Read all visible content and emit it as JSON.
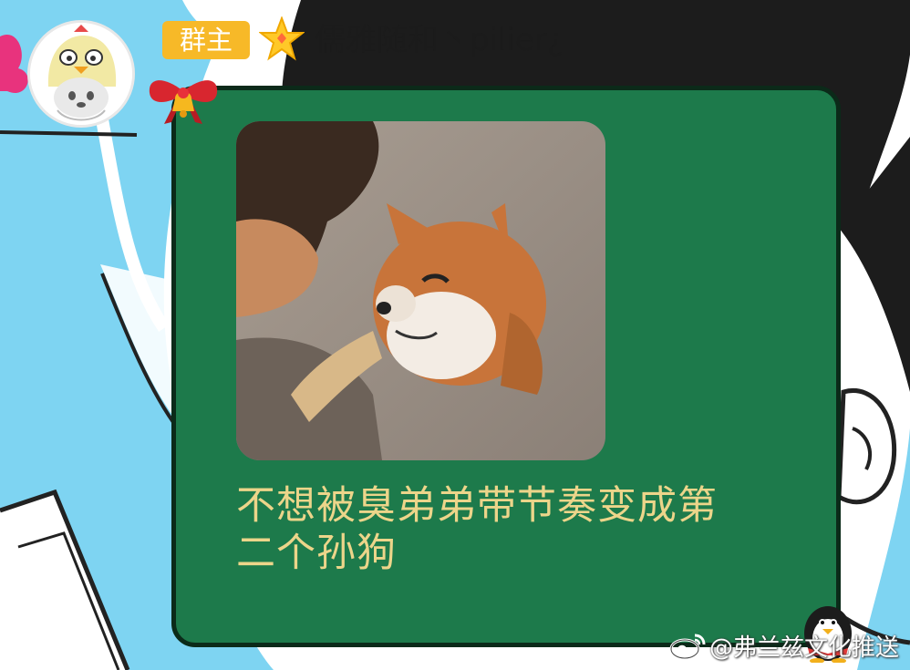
{
  "colors": {
    "sky": "#7ed4f2",
    "bubble": "#1d7a4b",
    "bubble_border": "#0b2a19",
    "message_text": "#ecd58a",
    "badge": "#f7b928",
    "hair": "#1c1c1c"
  },
  "header": {
    "role_badge": "群主",
    "nickname": "儒雅随和丶pilier¿",
    "avatar_icon": "chick-cat-avatar",
    "level_icon": "star-icon"
  },
  "bubble": {
    "decoration_icon": "bow-bell-icon",
    "image_icon": "shiba-meme-photo",
    "message_line1": "不想被臭弟弟带节奏变成第",
    "message_line2": "二个孙狗"
  },
  "watermark": {
    "icon": "weibo-icon",
    "text": "@弗兰兹文化推送"
  }
}
